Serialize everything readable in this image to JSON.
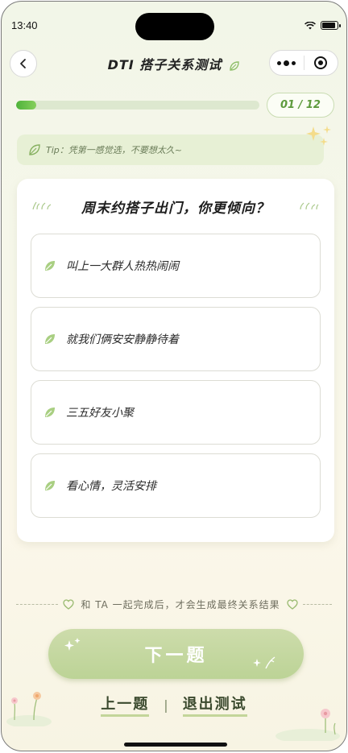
{
  "status_bar": {
    "time": "13:40"
  },
  "nav": {
    "title": "DTI 搭子关系测试"
  },
  "progress": {
    "label": "01 / 12",
    "current": 1,
    "total": 12
  },
  "tip": {
    "text": "Tip：凭第一感觉选，不要想太久~"
  },
  "question": {
    "text": "周末约搭子出门，你更倾向？",
    "options": [
      {
        "label": "叫上一大群人热热闹闹"
      },
      {
        "label": "就我们俩安安静静待着"
      },
      {
        "label": "三五好友小聚"
      },
      {
        "label": "看心情，灵活安排"
      }
    ]
  },
  "footer": {
    "note": "和 TA 一起完成后，才会生成最终关系结果",
    "next_label": "下一题",
    "prev_label": "上一题",
    "separator": "|",
    "exit_label": "退出测试"
  },
  "colors": {
    "accent": "#5d9a3c",
    "progress_fill": "#4fb33a",
    "button": "#c5d7a0"
  },
  "icons": [
    "back-arrow-icon",
    "leaf-icon",
    "more-icon",
    "close-target-icon",
    "sparkle-icon",
    "heart-icon",
    "grass-icon",
    "flower-icon"
  ]
}
